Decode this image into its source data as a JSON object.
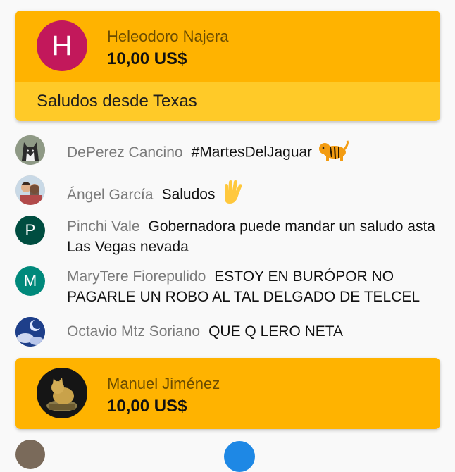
{
  "cards": [
    {
      "initial": "H",
      "avatar_color": "#c2185b",
      "name": "Heleodoro Najera",
      "amount": "10,00 US$",
      "message": "Saludos desde Texas"
    },
    {
      "name": "Manuel Jiménez",
      "amount": "10,00 US$"
    }
  ],
  "messages": [
    {
      "author": "DePerez Cancino",
      "text": "#MartesDelJaguar",
      "emoji": "tiger-icon"
    },
    {
      "author": "Ángel García",
      "text": "Saludos",
      "emoji": "raised-hand-icon"
    },
    {
      "author": "Pinchi Vale",
      "text": "Gobernadora puede mandar un saludo asta Las Vegas nevada",
      "initial": "P",
      "avatar_color": "#004d40"
    },
    {
      "author": "MaryTere Fiorepulido",
      "text": "ESTOY EN BURÓPOR NO PAGARLE UN ROBO AL TAL DELGADO DE TELCEL",
      "initial": "M",
      "avatar_color": "#00897b"
    },
    {
      "author": "Octavio Mtz Soriano",
      "text": "QUE Q LERO NETA"
    }
  ],
  "colors": {
    "card_header": "#ffb300",
    "card_message": "#ffca28",
    "author": "#7a7a7a"
  }
}
